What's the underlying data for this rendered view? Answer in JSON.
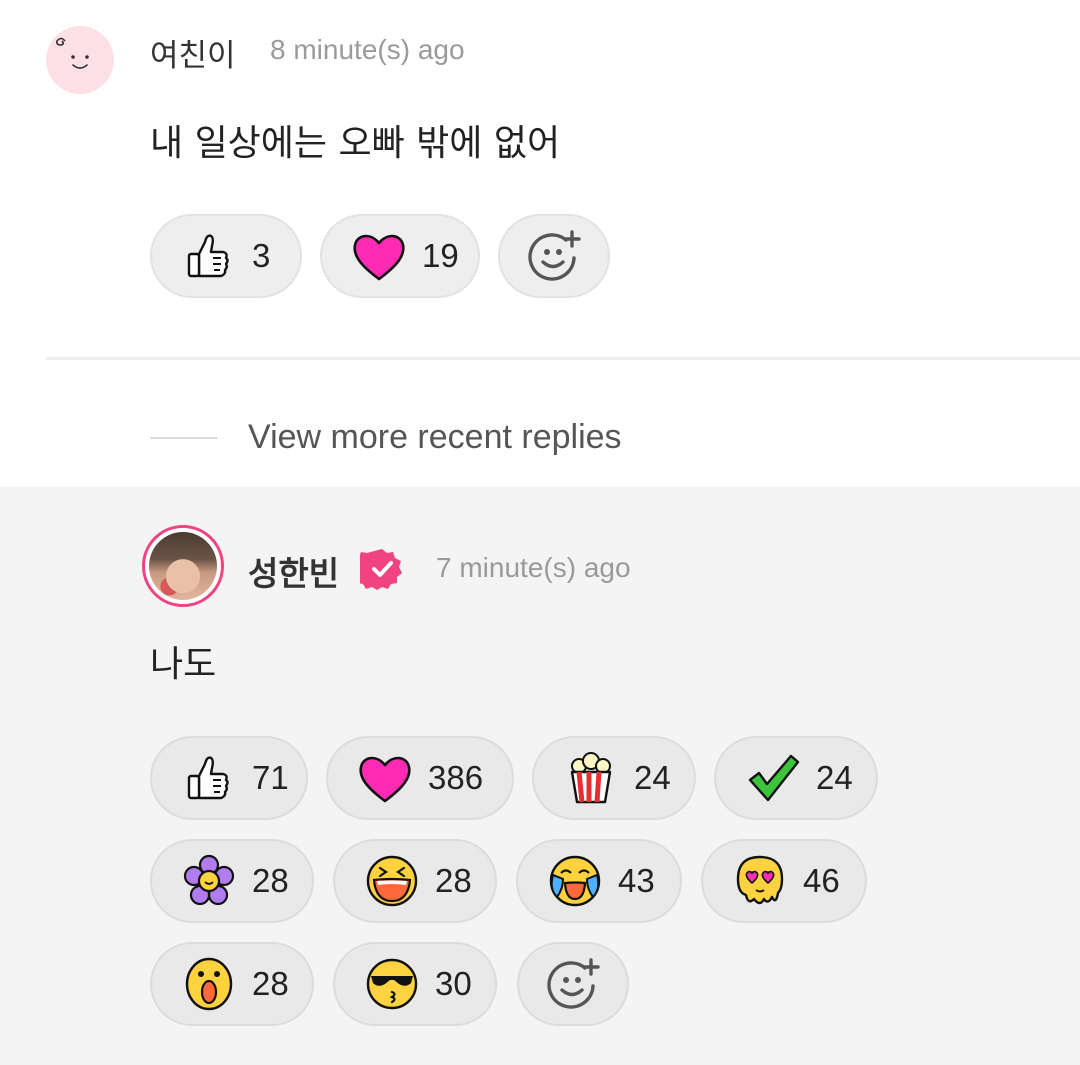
{
  "comment": {
    "username": "여친이",
    "time": "8 minute(s) ago",
    "text": "내 일상에는 오빠 밖에 없어",
    "reactions": [
      {
        "icon": "thumbs-up-icon",
        "count": "3"
      },
      {
        "icon": "pink-heart-icon",
        "count": "19"
      }
    ]
  },
  "view_more": {
    "label": "View more recent replies"
  },
  "reply": {
    "username": "성한빈",
    "verified_icon": "verified-badge-icon",
    "time": "7 minute(s) ago",
    "text": "나도",
    "reactions": [
      {
        "icon": "thumbs-up-icon",
        "count": "71"
      },
      {
        "icon": "pink-heart-icon",
        "count": "386"
      },
      {
        "icon": "popcorn-icon",
        "count": "24"
      },
      {
        "icon": "green-check-icon",
        "count": "24"
      },
      {
        "icon": "purple-flower-icon",
        "count": "28"
      },
      {
        "icon": "laughing-face-icon",
        "count": "28"
      },
      {
        "icon": "crying-laughing-face-icon",
        "count": "43"
      },
      {
        "icon": "melting-heart-eyes-face-icon",
        "count": "46"
      },
      {
        "icon": "surprised-face-icon",
        "count": "28"
      },
      {
        "icon": "sunglasses-kiss-face-icon",
        "count": "30"
      }
    ]
  },
  "colors": {
    "accent": "#f0437f",
    "heart": "#ff2bb4",
    "chip_bg": "#eeeeee",
    "reply_bg": "#f4f4f4"
  }
}
